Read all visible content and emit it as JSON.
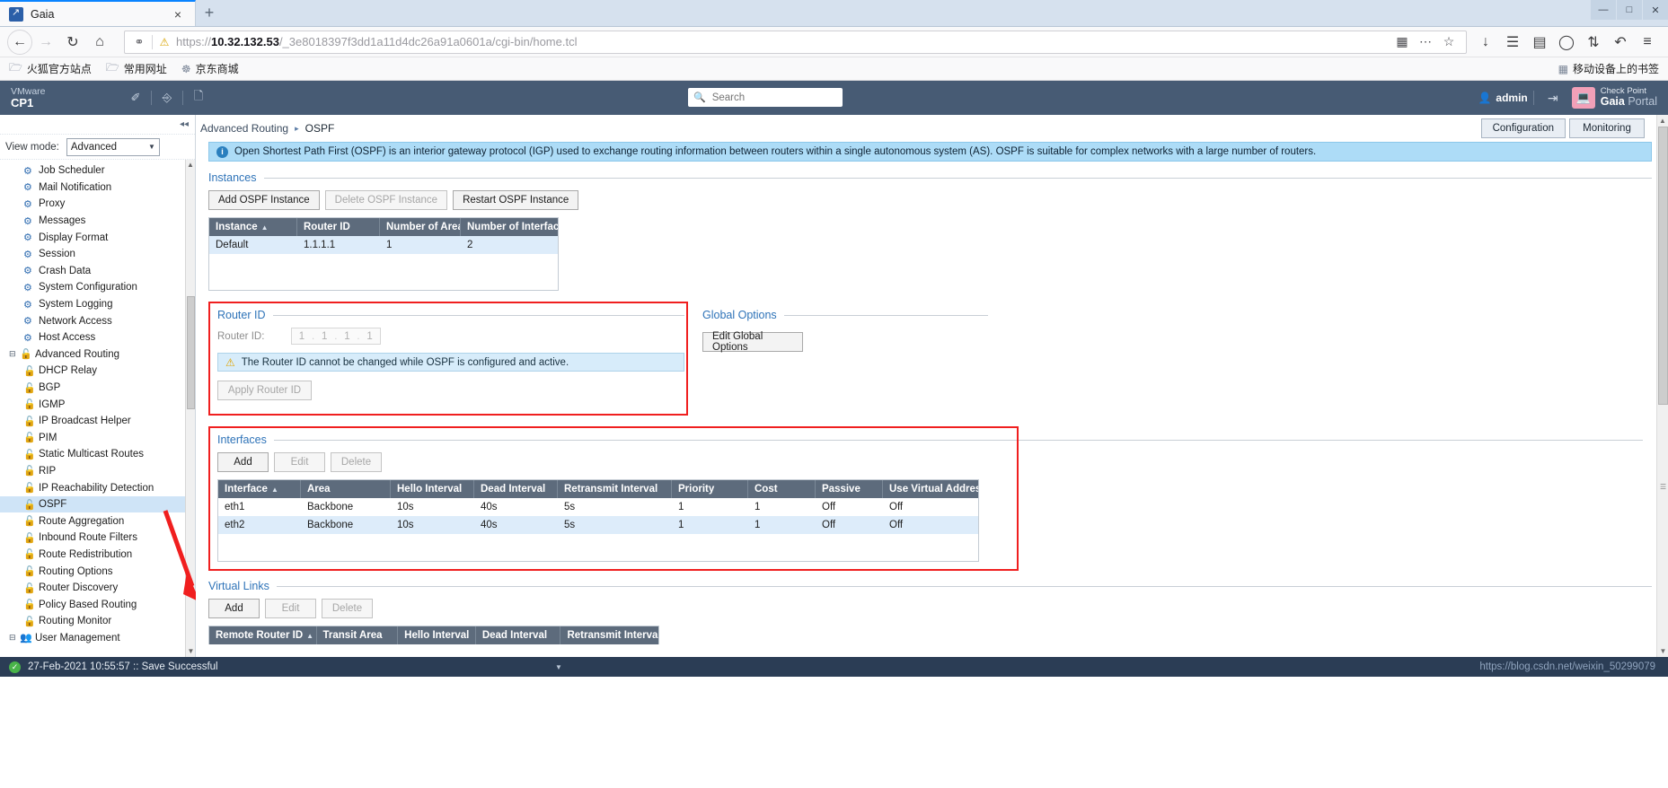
{
  "browser": {
    "tab": {
      "title": "Gaia",
      "favicon": "gaia-favicon",
      "close": "×"
    },
    "newtab_label": "+",
    "window_buttons": {
      "minimize": "—",
      "maximize": "□",
      "close": "✕"
    },
    "nav": {
      "back": "←",
      "forward": "→",
      "reload": "↻",
      "home": "⌂"
    },
    "url": {
      "scheme": "https://",
      "host": "10.32.132.53",
      "path": "/_3e8018397f3dd1a11d4dc26a91a0601a/cgi-bin/home.tcl",
      "full": "https://10.32.132.53/_3e8018397f3dd1a11d4dc26a91a0601a/cgi-bin/home.tcl",
      "shield_icon": "shield-icon",
      "lock_icon": "insecure-warning-icon",
      "reader_icon": "reader-view-icon",
      "more_icon": "page-actions-icon",
      "star_icon": "bookmark-star-icon"
    },
    "toolbar_right": {
      "downloads": "↓",
      "library": "☰",
      "sidebars": "▤",
      "account": "◯",
      "sync": "⇅",
      "history": "↶",
      "menu": "≡"
    },
    "bookmarks": [
      {
        "label": "火狐官方站点",
        "icon": "folder-icon"
      },
      {
        "label": "常用网址",
        "icon": "folder-icon"
      },
      {
        "label": "京东商城",
        "icon": "globe-icon"
      }
    ],
    "bookmarks_right": {
      "label": "移动设备上的书签",
      "icon": "mobile-bookmarks-icon"
    }
  },
  "gaia_header": {
    "vendor": "VMware",
    "hostname": "CP1",
    "tools": [
      {
        "name": "edit-icon",
        "glyph": "✐"
      },
      {
        "name": "terminal-icon",
        "glyph": "⌫"
      },
      {
        "name": "document-icon",
        "glyph": "☰"
      }
    ],
    "search": {
      "placeholder": "Search",
      "value": "",
      "icon": "search-icon"
    },
    "user": {
      "label": "admin",
      "icon": "user-icon"
    },
    "logout_icon": "logout-icon",
    "logo": {
      "line1": "Check Point",
      "line2_bold": "Gaia",
      "line2_rest": " Portal"
    }
  },
  "sidebar": {
    "collapse_icon": "collapse-sidebar-icon",
    "view_mode": {
      "label": "View mode:",
      "value": "Advanced",
      "caret": "▾"
    },
    "items": [
      {
        "label": "Job Scheduler",
        "icon": "gear-icon",
        "level": 2
      },
      {
        "label": "Mail Notification",
        "icon": "gear-icon",
        "level": 2
      },
      {
        "label": "Proxy",
        "icon": "gear-icon",
        "level": 2
      },
      {
        "label": "Messages",
        "icon": "gear-icon",
        "level": 2
      },
      {
        "label": "Display Format",
        "icon": "gear-icon",
        "level": 2
      },
      {
        "label": "Session",
        "icon": "gear-icon",
        "level": 2
      },
      {
        "label": "Crash Data",
        "icon": "gear-icon",
        "level": 2
      },
      {
        "label": "System Configuration",
        "icon": "gear-icon",
        "level": 2
      },
      {
        "label": "System Logging",
        "icon": "gear-icon",
        "level": 2
      },
      {
        "label": "Network Access",
        "icon": "gear-icon",
        "level": 2
      },
      {
        "label": "Host Access",
        "icon": "gear-icon",
        "level": 2
      },
      {
        "label": "Advanced Routing",
        "icon": "routing-icon",
        "level": 1,
        "twisty": "⊟"
      },
      {
        "label": "DHCP Relay",
        "icon": "routing-icon",
        "level": 2
      },
      {
        "label": "BGP",
        "icon": "routing-icon",
        "level": 2
      },
      {
        "label": "IGMP",
        "icon": "routing-icon",
        "level": 2
      },
      {
        "label": "IP Broadcast Helper",
        "icon": "routing-icon",
        "level": 2
      },
      {
        "label": "PIM",
        "icon": "routing-icon",
        "level": 2
      },
      {
        "label": "Static Multicast Routes",
        "icon": "routing-icon",
        "level": 2
      },
      {
        "label": "RIP",
        "icon": "routing-icon",
        "level": 2
      },
      {
        "label": "IP Reachability Detection",
        "icon": "routing-icon",
        "level": 2
      },
      {
        "label": "OSPF",
        "icon": "routing-icon",
        "level": 2,
        "selected": true
      },
      {
        "label": "Route Aggregation",
        "icon": "routing-icon",
        "level": 2
      },
      {
        "label": "Inbound Route Filters",
        "icon": "routing-icon",
        "level": 2
      },
      {
        "label": "Route Redistribution",
        "icon": "routing-icon",
        "level": 2
      },
      {
        "label": "Routing Options",
        "icon": "routing-icon",
        "level": 2
      },
      {
        "label": "Router Discovery",
        "icon": "routing-icon",
        "level": 2
      },
      {
        "label": "Policy Based Routing",
        "icon": "routing-icon",
        "level": 2
      },
      {
        "label": "Routing Monitor",
        "icon": "routing-icon",
        "level": 2
      },
      {
        "label": "User Management",
        "icon": "users-icon",
        "level": 1,
        "twisty": "⊟"
      }
    ]
  },
  "content": {
    "breadcrumb": {
      "parent": "Advanced Routing",
      "sep": "▸",
      "current": "OSPF"
    },
    "top_buttons": [
      {
        "label": "Configuration",
        "name": "configuration-button"
      },
      {
        "label": "Monitoring",
        "name": "monitoring-button"
      }
    ],
    "info_banner": {
      "icon": "info-icon",
      "text": "Open Shortest Path First (OSPF) is an interior gateway protocol (IGP) used to exchange routing information between routers within a single autonomous system (AS). OSPF is suitable for complex networks with a large number of routers."
    },
    "instances": {
      "title": "Instances",
      "buttons": [
        {
          "label": "Add OSPF Instance",
          "disabled": false
        },
        {
          "label": "Delete OSPF Instance",
          "disabled": true
        },
        {
          "label": "Restart OSPF Instance",
          "disabled": false
        }
      ],
      "columns": [
        "Instance",
        "Router ID",
        "Number of Areas",
        "Number of Interfaces"
      ],
      "sort_column": "Instance",
      "sort_arrow": "▲",
      "rows": [
        {
          "instance": "Default",
          "router_id": "1.1.1.1",
          "areas": "1",
          "interfaces": "2"
        }
      ]
    },
    "router_id": {
      "title": "Router ID",
      "field_label": "Router ID:",
      "octets": [
        "1",
        "1",
        "1",
        "1"
      ],
      "warning": {
        "icon": "warning-icon",
        "text": "The Router ID cannot be changed while OSPF is configured and active."
      },
      "apply_button": {
        "label": "Apply Router ID",
        "disabled": true
      }
    },
    "global_options": {
      "title": "Global Options",
      "button": {
        "label": "Edit Global Options"
      }
    },
    "interfaces": {
      "title": "Interfaces",
      "buttons": [
        {
          "label": "Add",
          "disabled": false
        },
        {
          "label": "Edit",
          "disabled": true
        },
        {
          "label": "Delete",
          "disabled": true
        }
      ],
      "columns": [
        "Interface",
        "Area",
        "Hello Interval",
        "Dead Interval",
        "Retransmit Interval",
        "Priority",
        "Cost",
        "Passive",
        "Use Virtual Address"
      ],
      "sort_column": "Interface",
      "sort_arrow": "▲",
      "rows": [
        {
          "interface": "eth1",
          "area": "Backbone",
          "hello": "10s",
          "dead": "40s",
          "retransmit": "5s",
          "priority": "1",
          "cost": "1",
          "passive": "Off",
          "virtual": "Off"
        },
        {
          "interface": "eth2",
          "area": "Backbone",
          "hello": "10s",
          "dead": "40s",
          "retransmit": "5s",
          "priority": "1",
          "cost": "1",
          "passive": "Off",
          "virtual": "Off"
        }
      ]
    },
    "virtual_links": {
      "title": "Virtual Links",
      "buttons": [
        {
          "label": "Add",
          "disabled": false
        },
        {
          "label": "Edit",
          "disabled": true
        },
        {
          "label": "Delete",
          "disabled": true
        }
      ],
      "columns": [
        "Remote Router ID",
        "Transit Area",
        "Hello Interval",
        "Dead Interval",
        "Retransmit Interval"
      ],
      "sort_column": "Remote Router ID",
      "sort_arrow": "▲",
      "rows": []
    }
  },
  "status_bar": {
    "icon": "success-icon",
    "message": "27-Feb-2021 10:55:57 :: Save Successful",
    "caret": "▼",
    "watermark": "https://blog.csdn.net/weixin_50299079"
  },
  "annotations": {
    "arrow_color": "#f01f1f",
    "highlight_color": "#f01f1f"
  }
}
